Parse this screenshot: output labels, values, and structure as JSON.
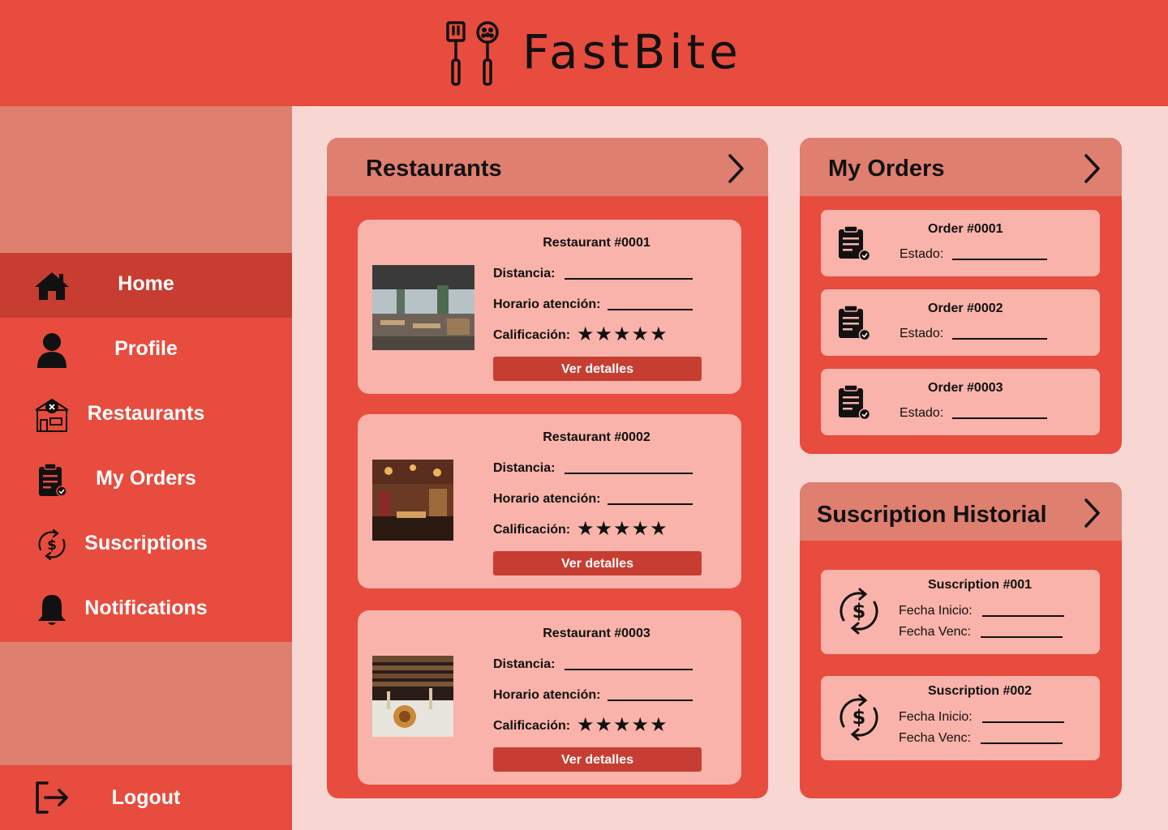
{
  "app": {
    "title": "FastBite"
  },
  "sidebar": {
    "items": [
      {
        "label": "Home",
        "icon": "home-icon",
        "active": true
      },
      {
        "label": "Profile",
        "icon": "user-icon",
        "active": false
      },
      {
        "label": "Restaurants",
        "icon": "restaurant-icon",
        "active": false
      },
      {
        "label": "My Orders",
        "icon": "orders-icon",
        "active": false
      },
      {
        "label": "Suscriptions",
        "icon": "subscription-icon",
        "active": false
      },
      {
        "label": "Notifications",
        "icon": "bell-icon",
        "active": false
      }
    ],
    "logout_label": "Logout"
  },
  "restaurants": {
    "title": "Restaurants",
    "cards": [
      {
        "name": "Restaurant #0001",
        "distance_label": "Distancia:",
        "hours_label": "Horario atención:",
        "rating_label": "Calificación:",
        "rating": 5,
        "stars": "★★★★★",
        "button": "Ver detalles"
      },
      {
        "name": "Restaurant #0002",
        "distance_label": "Distancia:",
        "hours_label": "Horario atención:",
        "rating_label": "Calificación:",
        "rating": 5,
        "stars": "★★★★★",
        "button": "Ver detalles"
      },
      {
        "name": "Restaurant #0003",
        "distance_label": "Distancia:",
        "hours_label": "Horario atención:",
        "rating_label": "Calificación:",
        "rating": 5,
        "stars": "★★★★★",
        "button": "Ver detalles"
      }
    ]
  },
  "orders": {
    "title": "My Orders",
    "items": [
      {
        "name": "Order #0001",
        "status_label": "Estado:"
      },
      {
        "name": "Order #0002",
        "status_label": "Estado:"
      },
      {
        "name": "Order #0003",
        "status_label": "Estado:"
      }
    ]
  },
  "subscriptions": {
    "title": "Suscription Historial",
    "items": [
      {
        "name": "Suscription #001",
        "start_label": "Fecha Inicio:",
        "end_label": "Fecha Venc:"
      },
      {
        "name": "Suscription #002",
        "start_label": "Fecha Inicio:",
        "end_label": "Fecha Venc:"
      }
    ]
  },
  "colors": {
    "primary": "#e74c3e",
    "header_band": "#df7f70",
    "active": "#c73d31",
    "card": "#f9b3aa",
    "background": "#f8d7d3"
  }
}
